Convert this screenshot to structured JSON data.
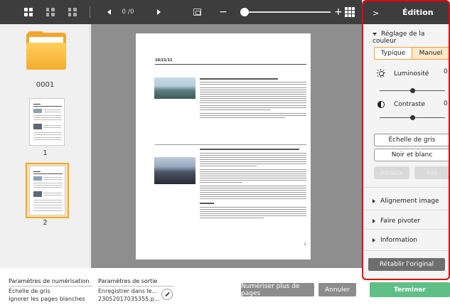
{
  "toolbar": {
    "page_counter": "0 /0",
    "zoom_minus": "−",
    "zoom_plus": "+",
    "zoom_level_fraction": 0.0
  },
  "thumbnails": {
    "folder_label": "0001",
    "page_labels": [
      "1",
      "2"
    ],
    "selected_page": "2"
  },
  "document": {
    "date": "10/21/11"
  },
  "edition": {
    "title": "Édition",
    "color_section": "Réglage de la couleur",
    "tabs": [
      "Typique",
      "Manuel"
    ],
    "active_tab": "Manuel",
    "brightness_label": "Luminosité",
    "brightness_value": "0",
    "brightness_fraction": 0.5,
    "contrast_label": "Contraste",
    "contrast_value": "0",
    "contrast_fraction": 0.5,
    "grayscale_button": "Échelle de gris",
    "bw_button": "Noir et blanc",
    "reset_button": "Rétablir",
    "apply_button": "Fait",
    "alignment": "Alignement image",
    "rotate": "Faire pivoter",
    "information": "Information",
    "restore_original": "Rétablir l'original"
  },
  "bottom": {
    "scan_params_title": "Paramètres de numérisation",
    "scan_param_1": "Échelle de gris",
    "scan_param_2": "Ignorer les pages blanches",
    "output_params_title": "Paramètres de sortie",
    "output_line_1": "Enregistrer dans le...",
    "output_line_2": "23052017035355.p...",
    "scan_more_button": "Numériser plus de pages",
    "cancel_button": "Annuler",
    "finish_button": "Terminer"
  },
  "colors": {
    "toolbar_bg": "#3d3d3d",
    "highlight_border": "#e3000f",
    "selection_orange": "#f5a623",
    "finish_green": "#5fbf86"
  }
}
